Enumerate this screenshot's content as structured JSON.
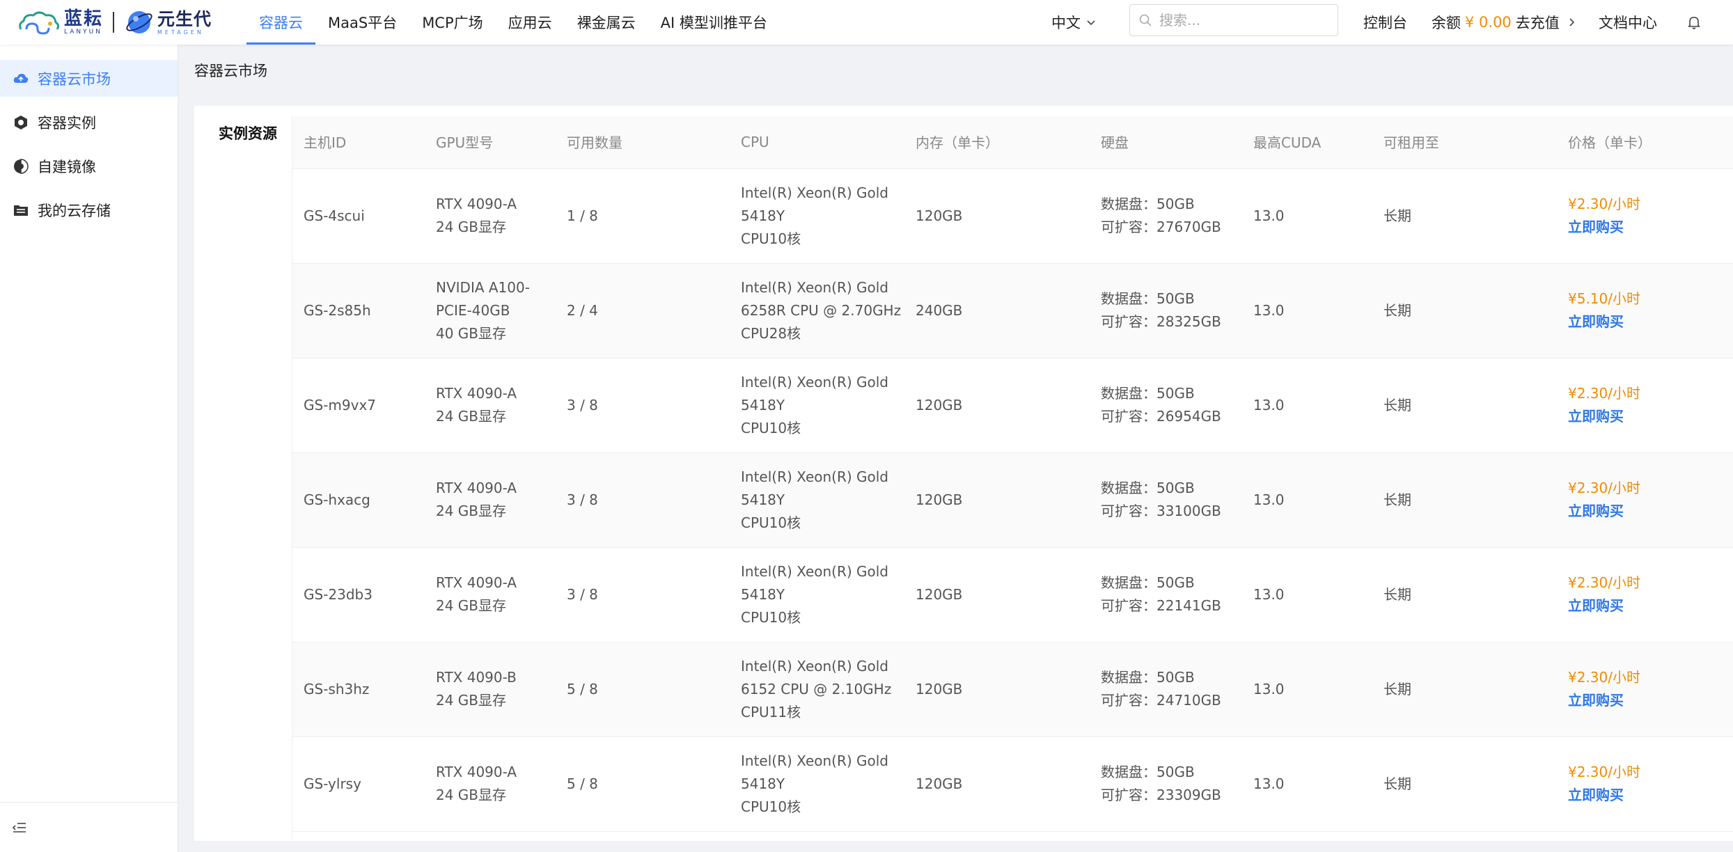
{
  "header": {
    "logo_lanyun_cn": "蓝耘",
    "logo_lanyun_en": "LANYUN",
    "logo_meta_cn": "元生代",
    "logo_meta_en": "METAGEN",
    "nav": [
      {
        "label": "容器云",
        "active": true
      },
      {
        "label": "MaaS平台",
        "active": false
      },
      {
        "label": "MCP广场",
        "active": false
      },
      {
        "label": "应用云",
        "active": false
      },
      {
        "label": "裸金属云",
        "active": false
      },
      {
        "label": "AI 模型训推平台",
        "active": false
      }
    ],
    "lang": "中文",
    "search_placeholder": "搜索...",
    "console": "控制台",
    "balance_label": "余额",
    "balance_amount": "¥ 0.00",
    "recharge": "去充值",
    "docs": "文档中心"
  },
  "sidebar": {
    "items": [
      {
        "label": "容器云市场",
        "icon": "cloud-icon",
        "active": true
      },
      {
        "label": "容器实例",
        "icon": "hexagon-icon",
        "active": false
      },
      {
        "label": "自建镜像",
        "icon": "image-icon",
        "active": false
      },
      {
        "label": "我的云存储",
        "icon": "folder-icon",
        "active": false
      }
    ]
  },
  "main": {
    "breadcrumb": "容器云市场",
    "section_label": "实例资源",
    "columns": [
      "主机ID",
      "GPU型号",
      "可用数量",
      "CPU",
      "内存（单卡）",
      "硬盘",
      "最高CUDA",
      "可租用至",
      "价格（单卡）"
    ],
    "buy_label": "立即购买",
    "rows": [
      {
        "id": "GS-4scui",
        "gpu": [
          "RTX 4090-A",
          "24 GB显存"
        ],
        "qty": "1 / 8",
        "cpu": [
          "Intel(R) Xeon(R) Gold",
          "5418Y",
          "CPU10核"
        ],
        "mem": "120GB",
        "disk": [
          "数据盘：50GB",
          "可扩容：27670GB"
        ],
        "cuda": "13.0",
        "until": "长期",
        "price": "¥2.30/小时"
      },
      {
        "id": "GS-2s85h",
        "gpu": [
          "NVIDIA A100-",
          "PCIE-40GB",
          "40 GB显存"
        ],
        "qty": "2 / 4",
        "cpu": [
          "Intel(R) Xeon(R) Gold",
          "6258R CPU @ 2.70GHz",
          "CPU28核"
        ],
        "mem": "240GB",
        "disk": [
          "数据盘：50GB",
          "可扩容：28325GB"
        ],
        "cuda": "13.0",
        "until": "长期",
        "price": "¥5.10/小时"
      },
      {
        "id": "GS-m9vx7",
        "gpu": [
          "RTX 4090-A",
          "24 GB显存"
        ],
        "qty": "3 / 8",
        "cpu": [
          "Intel(R) Xeon(R) Gold",
          "5418Y",
          "CPU10核"
        ],
        "mem": "120GB",
        "disk": [
          "数据盘：50GB",
          "可扩容：26954GB"
        ],
        "cuda": "13.0",
        "until": "长期",
        "price": "¥2.30/小时"
      },
      {
        "id": "GS-hxacg",
        "gpu": [
          "RTX 4090-A",
          "24 GB显存"
        ],
        "qty": "3 / 8",
        "cpu": [
          "Intel(R) Xeon(R) Gold",
          "5418Y",
          "CPU10核"
        ],
        "mem": "120GB",
        "disk": [
          "数据盘：50GB",
          "可扩容：33100GB"
        ],
        "cuda": "13.0",
        "until": "长期",
        "price": "¥2.30/小时"
      },
      {
        "id": "GS-23db3",
        "gpu": [
          "RTX 4090-A",
          "24 GB显存"
        ],
        "qty": "3 / 8",
        "cpu": [
          "Intel(R) Xeon(R) Gold",
          "5418Y",
          "CPU10核"
        ],
        "mem": "120GB",
        "disk": [
          "数据盘：50GB",
          "可扩容：22141GB"
        ],
        "cuda": "13.0",
        "until": "长期",
        "price": "¥2.30/小时"
      },
      {
        "id": "GS-sh3hz",
        "gpu": [
          "RTX 4090-B",
          "24 GB显存"
        ],
        "qty": "5 / 8",
        "cpu": [
          "Intel(R) Xeon(R) Gold",
          "6152 CPU @ 2.10GHz",
          "CPU11核"
        ],
        "mem": "120GB",
        "disk": [
          "数据盘：50GB",
          "可扩容：24710GB"
        ],
        "cuda": "13.0",
        "until": "长期",
        "price": "¥2.30/小时"
      },
      {
        "id": "GS-ylrsy",
        "gpu": [
          "RTX 4090-A",
          "24 GB显存"
        ],
        "qty": "5 / 8",
        "cpu": [
          "Intel(R) Xeon(R) Gold",
          "5418Y",
          "CPU10核"
        ],
        "mem": "120GB",
        "disk": [
          "数据盘：50GB",
          "可扩容：23309GB"
        ],
        "cuda": "13.0",
        "until": "长期",
        "price": "¥2.30/小时"
      }
    ]
  },
  "colors": {
    "accent": "#3d7ff5",
    "price": "#f08c00",
    "buy_link": "#2f78e8"
  }
}
